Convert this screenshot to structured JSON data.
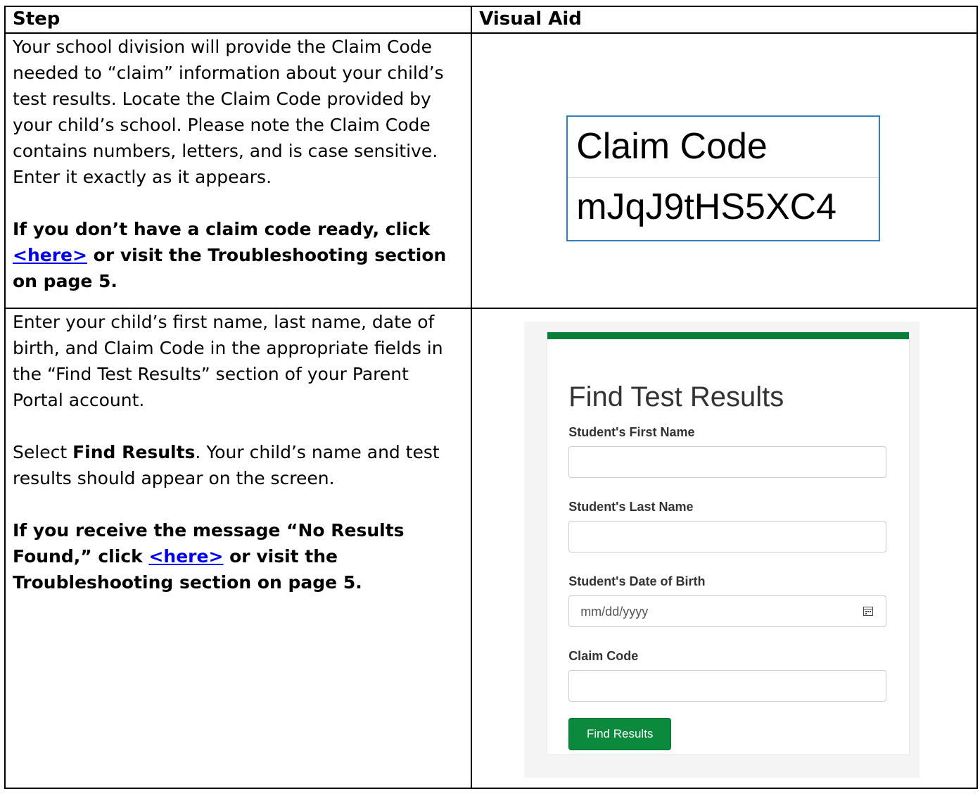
{
  "table": {
    "headers": {
      "step": "Step",
      "visual_aid": "Visual Aid"
    }
  },
  "row1": {
    "paragraph": "Your school division will provide the Claim Code needed to “claim” information about your child’s test results. Locate the Claim Code provided by your child’s school. Please note the Claim Code contains numbers, letters, and is case sensitive. Enter it exactly as it appears.",
    "note_before": "If you don’t have a claim code ready, click ",
    "note_link": "<here>",
    "note_after": " or visit the Troubleshooting section on page 5.",
    "claim_box": {
      "label": "Claim Code",
      "value": "mJqJ9tHS5XC4"
    }
  },
  "row2": {
    "paragraph1": "Enter your child’s first name, last name, date of birth, and Claim Code in the appropriate fields in the “Find Test Results” section of your Parent Portal account.",
    "select_prefix": "Select ",
    "select_bold": "Find Results",
    "select_suffix": ". Your child’s name and test results should appear on the screen.",
    "note_before": "If you receive the message “No Results Found,” click ",
    "note_link": "<here>",
    "note_after": " or visit the Troubleshooting section on page 5.",
    "form": {
      "title": "Find Test Results",
      "first_name_label": "Student's First Name",
      "last_name_label": "Student's Last Name",
      "dob_label": "Student's Date of Birth",
      "dob_placeholder": "mm/dd/yyyy",
      "claim_code_label": "Claim Code",
      "button_label": "Find Results",
      "accent_color": "#0b7d3a"
    }
  }
}
